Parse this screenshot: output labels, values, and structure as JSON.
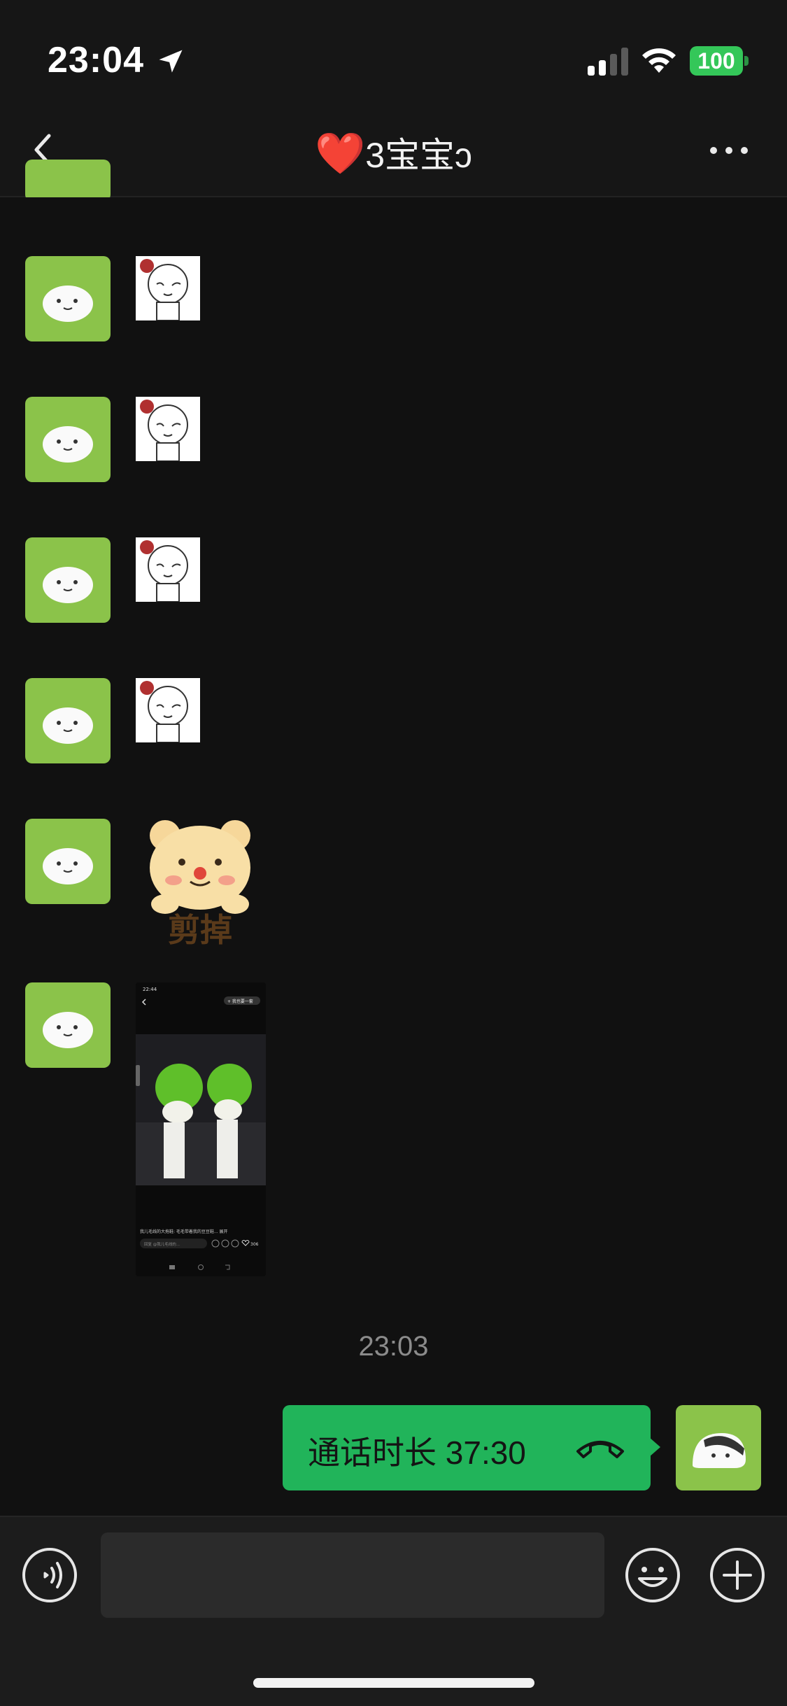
{
  "status_bar": {
    "time": "23:04",
    "battery": "100",
    "icons": [
      "location-arrow-icon",
      "signal-icon",
      "wifi-icon",
      "battery-icon"
    ]
  },
  "nav": {
    "title_heart": "❤️",
    "title_text": "3宝宝",
    "title_suffix": "ↄ",
    "back_icon": "chevron-left-icon",
    "more_icon": "more-dots-icon"
  },
  "messages": {
    "timestamp": "23:03",
    "call_text": "通话时长 37:30",
    "bear_sticker_text": "剪掉",
    "screenshot_time": "22:44",
    "screenshot_button": "+ 我也要一套",
    "screenshot_caption": "我儿毛线的大拖鞋: 毛毛带着我的豆豆鞋... 展开",
    "screenshot_comment_placeholder": "回复 @我儿毛线的...",
    "screenshot_likes": "306"
  },
  "colors": {
    "bubble_green": "#21b45a",
    "background": "#111111",
    "battery_green": "#34c759"
  }
}
